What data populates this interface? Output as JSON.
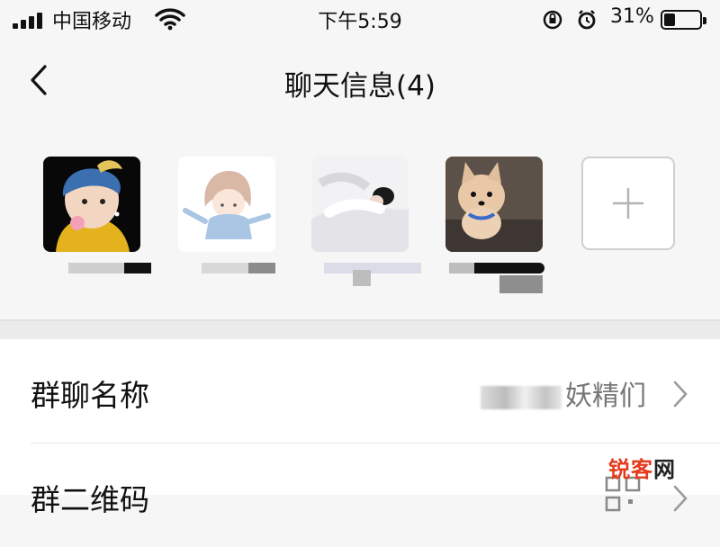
{
  "status_bar": {
    "carrier": "中国移动",
    "time": "下午5:59",
    "battery_percent": "31%",
    "battery_level": 0.31,
    "icons": [
      "signal-icon",
      "wifi-icon",
      "rotation-lock-icon",
      "alarm-icon",
      "battery-icon"
    ]
  },
  "nav": {
    "title": "聊天信息(4)",
    "back_icon": "chevron-left-icon"
  },
  "members": [
    {
      "avatar": "girl-with-pearl-earring-avatar"
    },
    {
      "avatar": "anime-girl-avatar"
    },
    {
      "avatar": "sleeping-girl-avatar"
    },
    {
      "avatar": "pomeranian-dog-avatar"
    }
  ],
  "add_member_icon": "plus-icon",
  "settings": {
    "group_name_label": "群聊名称",
    "group_name_value_visible": "妖精们",
    "qr_label": "群二维码"
  },
  "watermark": {
    "part1": "锐客",
    "part2": "网"
  },
  "colors": {
    "background": "#f6f6f6",
    "row_background": "#ffffff",
    "watermark": "#e53b1d"
  }
}
